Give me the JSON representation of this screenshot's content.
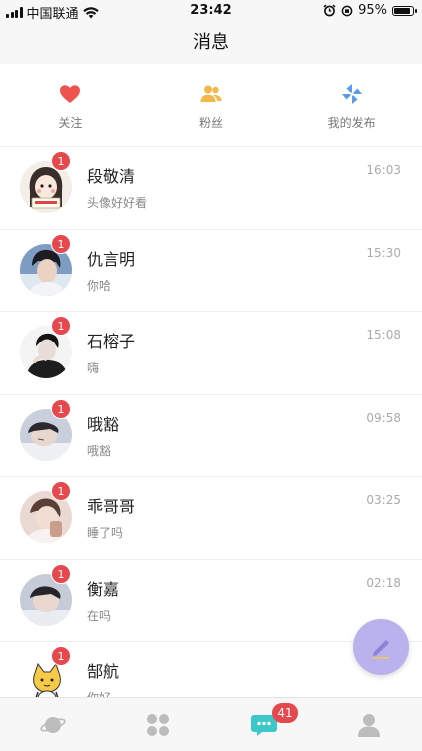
{
  "status_bar": {
    "carrier": "中国联通",
    "time": "23:42",
    "battery": "95%",
    "battery_level": 0.95
  },
  "header": {
    "title": "消息"
  },
  "quick_actions": [
    {
      "label": "关注",
      "icon": "heart-icon",
      "color": "#ef5350"
    },
    {
      "label": "粉丝",
      "icon": "fans-icon",
      "color": "#f2b84b"
    },
    {
      "label": "我的发布",
      "icon": "pinwheel-icon",
      "color": "#5b9be8"
    }
  ],
  "messages": [
    {
      "name": "段敬清",
      "preview": "头像好好看",
      "time": "16:03",
      "unread": "1"
    },
    {
      "name": "仇言明",
      "preview": "你哈",
      "time": "15:30",
      "unread": "1"
    },
    {
      "name": "石榕子",
      "preview": "嗨",
      "time": "15:08",
      "unread": "1"
    },
    {
      "name": "哦豁",
      "preview": "哦豁",
      "time": "09:58",
      "unread": "1"
    },
    {
      "name": "乖哥哥",
      "preview": "睡了吗",
      "time": "03:25",
      "unread": "1"
    },
    {
      "name": "衡嘉",
      "preview": "在吗",
      "time": "02:18",
      "unread": "1"
    },
    {
      "name": "郜航",
      "preview": "你好",
      "time": "",
      "unread": "1"
    }
  ],
  "tab_bar": {
    "tabs": [
      {
        "icon": "planet-icon"
      },
      {
        "icon": "grid-icon"
      },
      {
        "icon": "chat-icon",
        "active": true
      },
      {
        "icon": "profile-icon"
      }
    ],
    "messages_badge": "41",
    "active_color": "#3cc8c8"
  },
  "fab": {
    "icon": "pen-icon",
    "color": "#b9b2ec"
  }
}
